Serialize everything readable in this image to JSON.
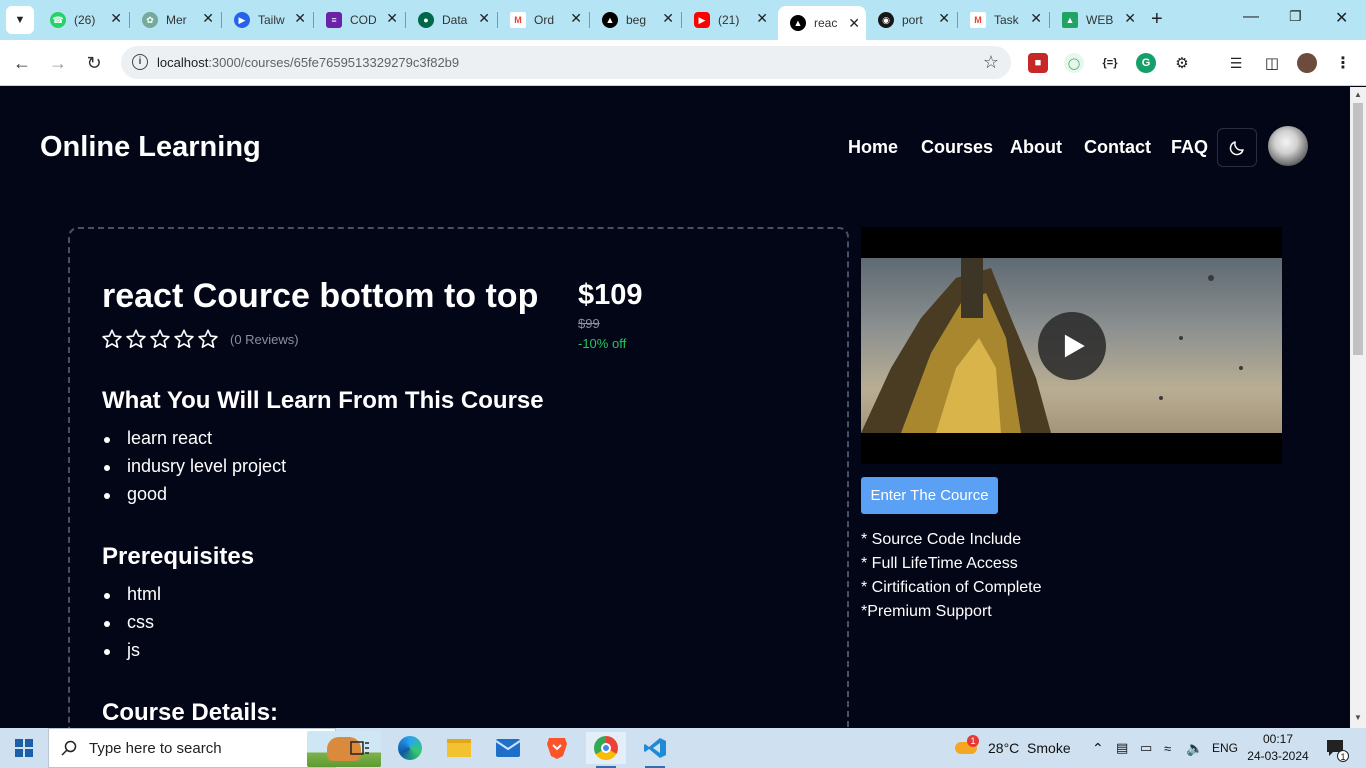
{
  "browser": {
    "tabs": [
      {
        "title": "(26)",
        "icon": "whatsapp-icon",
        "color": "#25d366"
      },
      {
        "title": "Mer",
        "icon": "chatgpt-icon",
        "color": "#74aa9c"
      },
      {
        "title": "Tailw",
        "icon": "tailwind-play-icon",
        "color": "#2563eb"
      },
      {
        "title": "COD",
        "icon": "code-icon",
        "color": "#6b21a8"
      },
      {
        "title": "Data",
        "icon": "mongodb-icon",
        "color": "#00684a"
      },
      {
        "title": "Ord",
        "icon": "gmail-icon",
        "color": "#ea4335"
      },
      {
        "title": "beg",
        "icon": "nextjs-icon",
        "color": "#000000"
      },
      {
        "title": "(21)",
        "icon": "youtube-icon",
        "color": "#ff0000"
      },
      {
        "title": "reac",
        "icon": "nextjs-icon",
        "color": "#000000"
      },
      {
        "title": "port",
        "icon": "github-icon",
        "color": "#181717"
      },
      {
        "title": "Task",
        "icon": "gmail-icon",
        "color": "#ea4335"
      },
      {
        "title": "WEB",
        "icon": "google-drive-icon",
        "color": "#1fa463"
      }
    ],
    "url_host": "localhost",
    "url_path": ":3000/courses/65fe7659513329279c3f82b9"
  },
  "site": {
    "brand": "Online Learning",
    "nav": [
      "Home",
      "Courses",
      "About",
      "Contact",
      "FAQ"
    ]
  },
  "course": {
    "title": "react Cource bottom to top",
    "rating": 0,
    "reviews_text": "(0 Reviews)",
    "price": "$109",
    "old_price": "$99",
    "discount": "-10% off",
    "learn_heading": "What You Will Learn From This Course",
    "learn_items": [
      "learn react",
      "indusry level project",
      "good"
    ],
    "prereq_heading": "Prerequisites",
    "prereq_items": [
      "html",
      "css",
      "js"
    ],
    "details_heading": "Course Details:",
    "enter_button": "Enter The Cource",
    "features": [
      "* Source Code Include",
      "* Full LifeTime Access",
      "* Cirtification of Complete",
      "*Premium Support"
    ]
  },
  "taskbar": {
    "search_placeholder": "Type here to search",
    "weather": "28°C  Smoke",
    "weather_badge": "1",
    "language": "ENG",
    "time": "00:17",
    "date": "24-03-2024",
    "notifications": "1"
  }
}
